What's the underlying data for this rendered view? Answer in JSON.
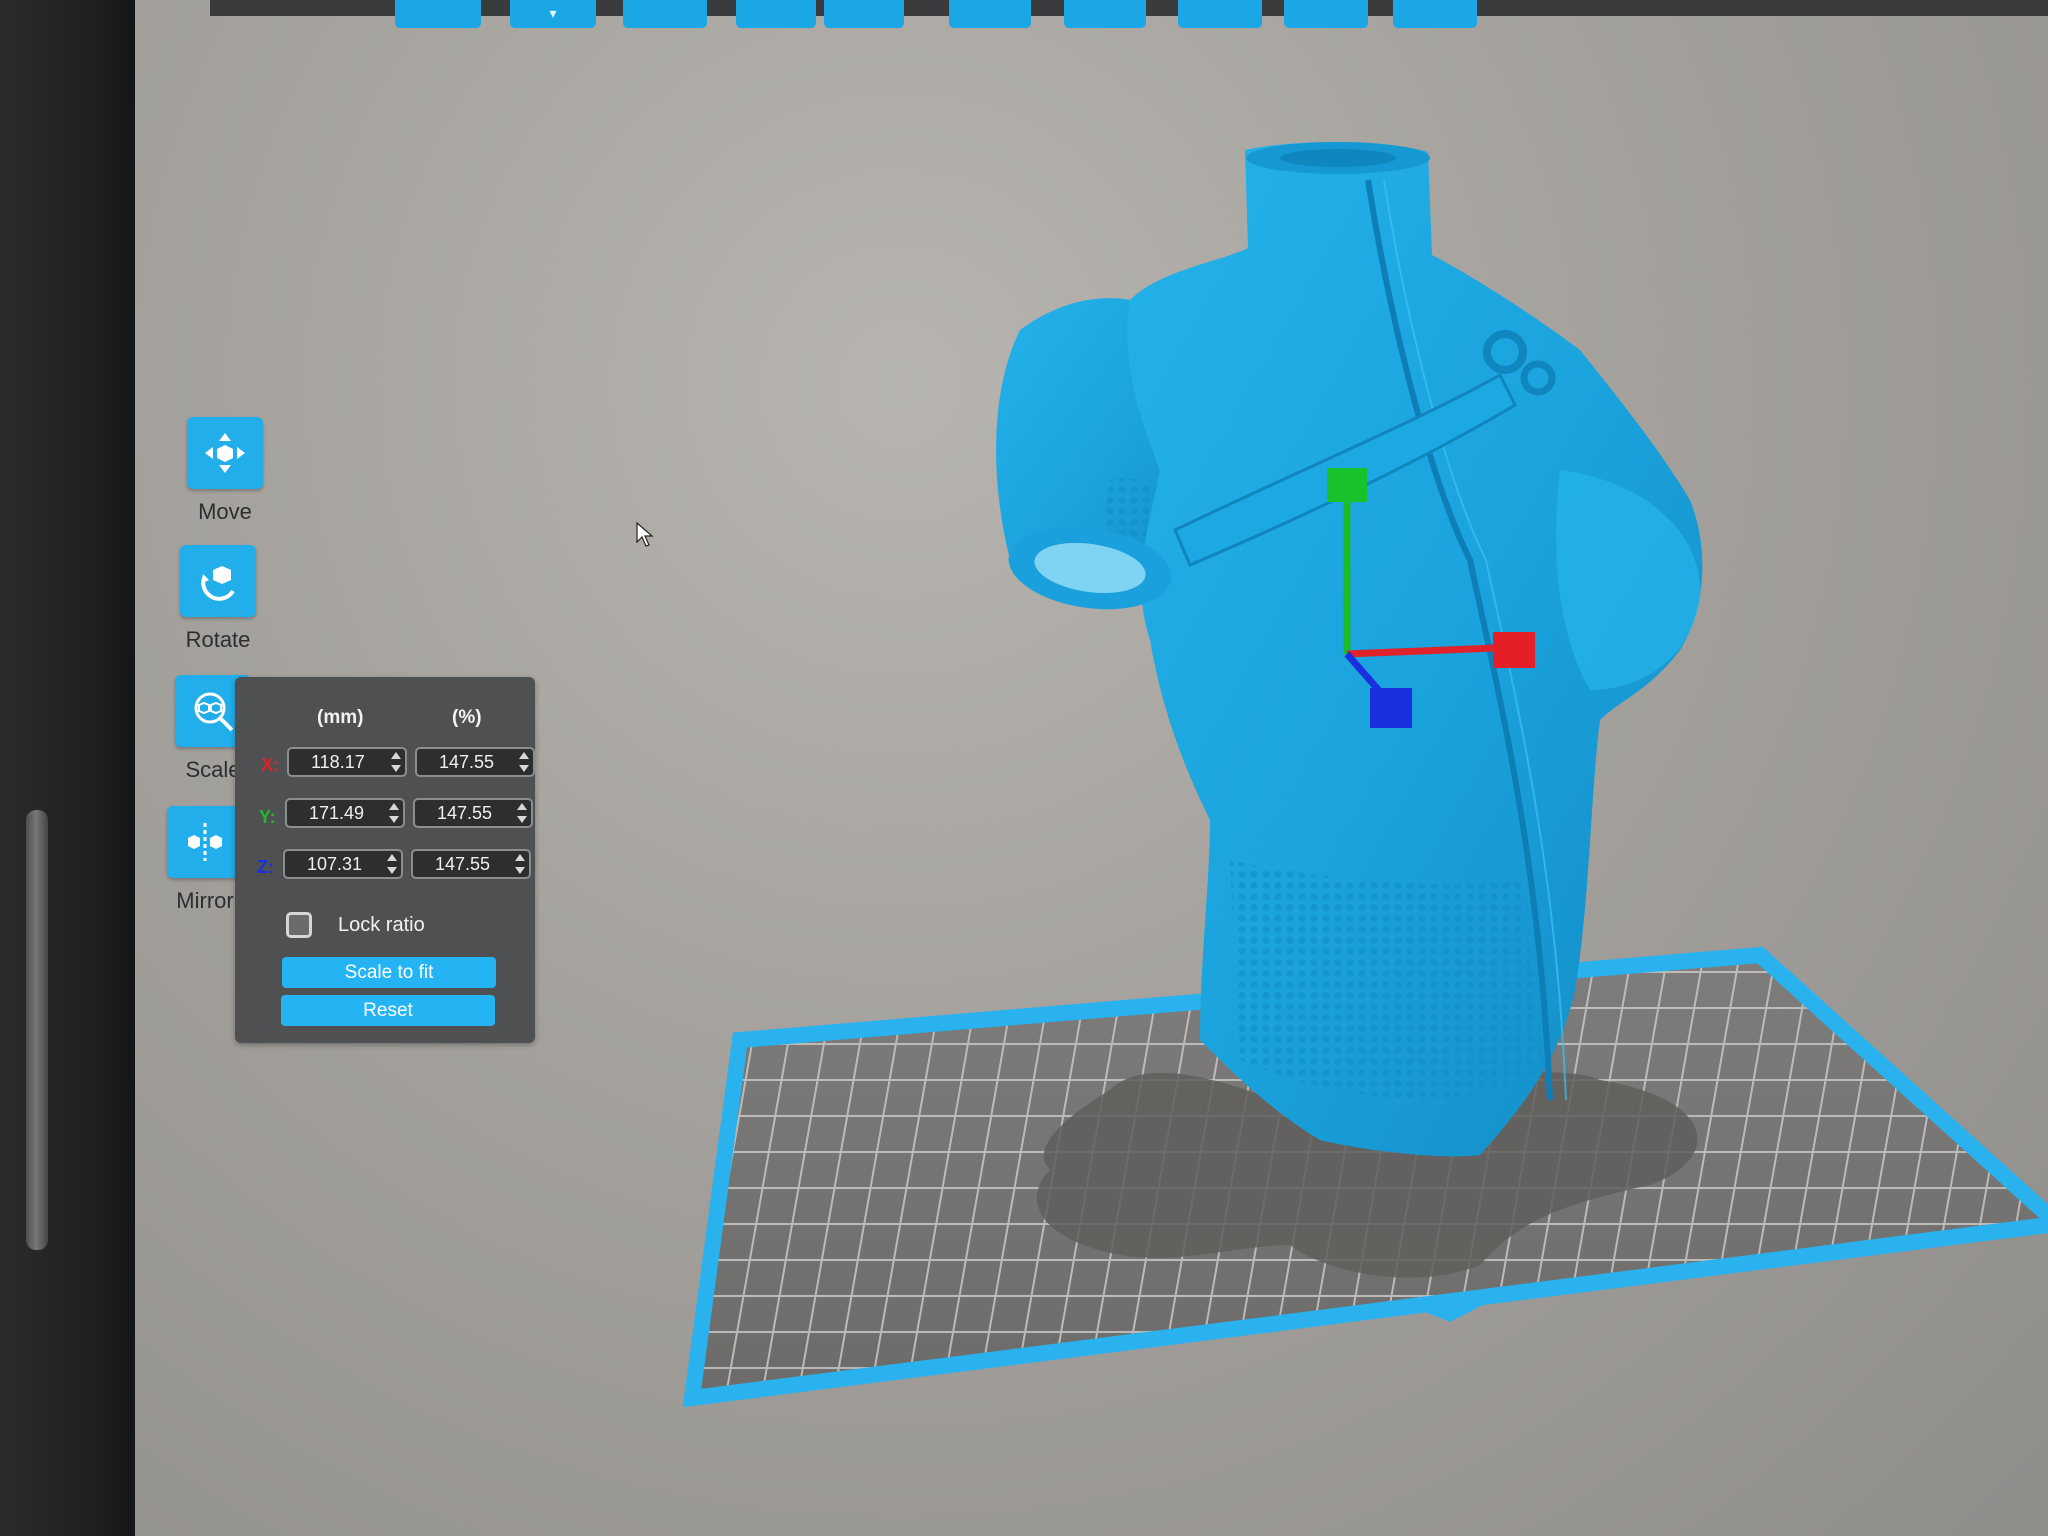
{
  "tools": {
    "move_label": "Move",
    "rotate_label": "Rotate",
    "scale_label": "Scale",
    "mirror_label": "Mirror"
  },
  "scale_panel": {
    "header_mm": "(mm)",
    "header_pct": "(%)",
    "rows": [
      {
        "axis": "X:",
        "mm": "118.17",
        "pct": "147.55"
      },
      {
        "axis": "Y:",
        "mm": "171.49",
        "pct": "147.55"
      },
      {
        "axis": "Z:",
        "mm": "107.31",
        "pct": "147.55"
      }
    ],
    "lock_ratio_label": "Lock ratio",
    "lock_ratio_checked": false,
    "scale_to_fit_label": "Scale to fit",
    "reset_label": "Reset"
  },
  "colors": {
    "accent": "#1ba6e6",
    "model": "#1aa6dd",
    "axis_x": "#e0222a",
    "axis_y": "#1bbb2a",
    "axis_z": "#1a2fe0"
  }
}
